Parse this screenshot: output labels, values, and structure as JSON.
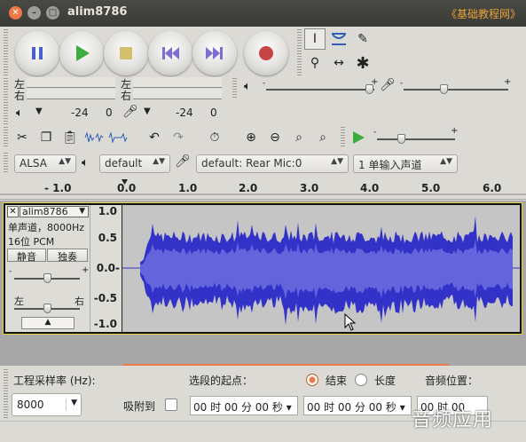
{
  "window": {
    "title": "alim8786",
    "source_tag": "《基础教程网》"
  },
  "meters": {
    "left_ch": "左",
    "right_ch": "右",
    "play_left": "左",
    "play_right": "右",
    "vol_a": "-24",
    "zero_a": "0",
    "vol_b": "-24",
    "zero_b": "0"
  },
  "devices": {
    "host": "ALSA",
    "output": "default",
    "input": "default: Rear Mic:0",
    "channels": "1 单输入声道"
  },
  "ruler": {
    "ticks": [
      "- 1.0",
      "0.0",
      "1.0",
      "2.0",
      "3.0",
      "4.0",
      "5.0",
      "6.0"
    ]
  },
  "track": {
    "name": "alim8786",
    "info_line1": "单声道，8000Hz",
    "info_line2": "16位 PCM",
    "mute_label": "静音",
    "solo_label": "独奏",
    "pan_left": "左",
    "pan_right": "右",
    "scale": [
      "1.0",
      "0.5",
      "0.0-",
      "-0.5",
      "-1.0"
    ]
  },
  "bottom": {
    "rate_label": "工程采样率 (Hz):",
    "rate_value": "8000",
    "snap_label": "吸附到",
    "sel_start_label": "选段的起点：",
    "end_label": "结束",
    "length_label": "长度",
    "audio_pos_label": "音频位置：",
    "time_start": "00 时 00 分 00 秒",
    "time_end": "00 时 00 分 00 秒",
    "time_pos": "00 时 00",
    "watermark": "音频应用"
  },
  "colors": {
    "wave": "#3232c8",
    "wave_light": "#6464dc",
    "accent": "#f07746"
  }
}
